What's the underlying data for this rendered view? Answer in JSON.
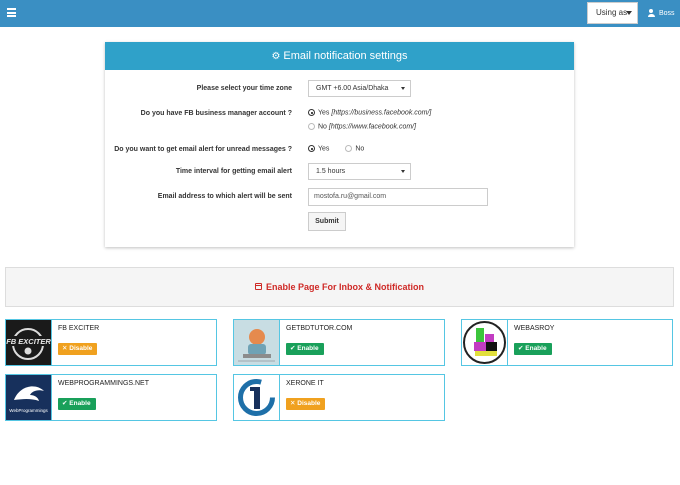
{
  "header": {
    "using_as_label": "Using as",
    "user_name": "Boss"
  },
  "settings": {
    "title": "Email notification settings",
    "timezone_label": "Please select your time zone",
    "timezone_value": "GMT +6.00 Asia/Dhaka",
    "fb_business_label": "Do you have FB business manager account ?",
    "fb_yes": "Yes",
    "fb_yes_hint": "[https://business.facebook.com/]",
    "fb_no": "No",
    "fb_no_hint": "[https://www.facebook.com/]",
    "unread_label": "Do you want to get email alert for unread messages ?",
    "unread_yes": "Yes",
    "unread_no": "No",
    "interval_label": "Time interval for getting email alert",
    "interval_value": "1.5 hours",
    "email_label": "Email address to which alert will be sent",
    "email_value": "mostofa.ru@gmail.com",
    "submit_label": "Submit"
  },
  "banner": {
    "title": "Enable Page For Inbox & Notification"
  },
  "pages": [
    {
      "name": "FB EXCITER",
      "status": "Disable",
      "logo_text": "FB EXCITER"
    },
    {
      "name": "GETBDTUTOR.COM",
      "status": "Enable"
    },
    {
      "name": "WEBASROY",
      "status": "Enable"
    },
    {
      "name": "WEBPROGRAMMINGS.NET",
      "status": "Enable",
      "logo_text": "WebProgrammings"
    },
    {
      "name": "XERONE IT",
      "status": "Disable"
    }
  ],
  "colors": {
    "topbar": "#3a8fc3",
    "panel_header": "#2fa1c9",
    "banner_text": "#cf2a27",
    "enable": "#19a05a",
    "disable": "#f0a11f",
    "card_border": "#55c6e3"
  }
}
